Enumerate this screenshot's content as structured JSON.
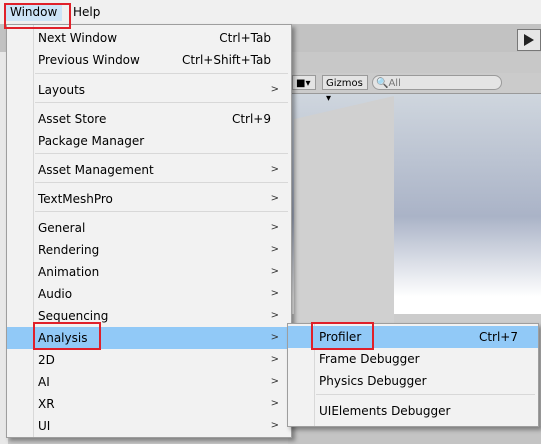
{
  "menubar": {
    "items": [
      {
        "label": "Window",
        "active": true
      },
      {
        "label": "Help",
        "active": false
      }
    ]
  },
  "scene": {
    "gizmos_label": "Gizmos",
    "search_placeholder": "All"
  },
  "window_menu": {
    "items": [
      {
        "label": "Next Window",
        "shortcut": "Ctrl+Tab",
        "submenu": false
      },
      {
        "label": "Previous Window",
        "shortcut": "Ctrl+Shift+Tab",
        "submenu": false
      },
      {
        "label": "Layouts",
        "shortcut": "",
        "submenu": true
      },
      {
        "label": "Asset Store",
        "shortcut": "Ctrl+9",
        "submenu": false
      },
      {
        "label": "Package Manager",
        "shortcut": "",
        "submenu": false
      },
      {
        "label": "Asset Management",
        "shortcut": "",
        "submenu": true
      },
      {
        "label": "TextMeshPro",
        "shortcut": "",
        "submenu": true
      },
      {
        "label": "General",
        "shortcut": "",
        "submenu": true
      },
      {
        "label": "Rendering",
        "shortcut": "",
        "submenu": true
      },
      {
        "label": "Animation",
        "shortcut": "",
        "submenu": true
      },
      {
        "label": "Audio",
        "shortcut": "",
        "submenu": true
      },
      {
        "label": "Sequencing",
        "shortcut": "",
        "submenu": true
      },
      {
        "label": "Analysis",
        "shortcut": "",
        "submenu": true,
        "highlighted": true
      },
      {
        "label": "2D",
        "shortcut": "",
        "submenu": true
      },
      {
        "label": "AI",
        "shortcut": "",
        "submenu": true
      },
      {
        "label": "XR",
        "shortcut": "",
        "submenu": true
      },
      {
        "label": "UI",
        "shortcut": "",
        "submenu": true
      }
    ]
  },
  "analysis_submenu": {
    "items": [
      {
        "label": "Profiler",
        "shortcut": "Ctrl+7",
        "highlighted": true
      },
      {
        "label": "Frame Debugger",
        "shortcut": ""
      },
      {
        "label": "Physics Debugger",
        "shortcut": ""
      },
      {
        "label": "UIElements Debugger",
        "shortcut": ""
      }
    ]
  },
  "colors": {
    "highlight": "#91c9f7",
    "callout_border": "#e0202a",
    "menu_bg": "#f2f2f2"
  }
}
